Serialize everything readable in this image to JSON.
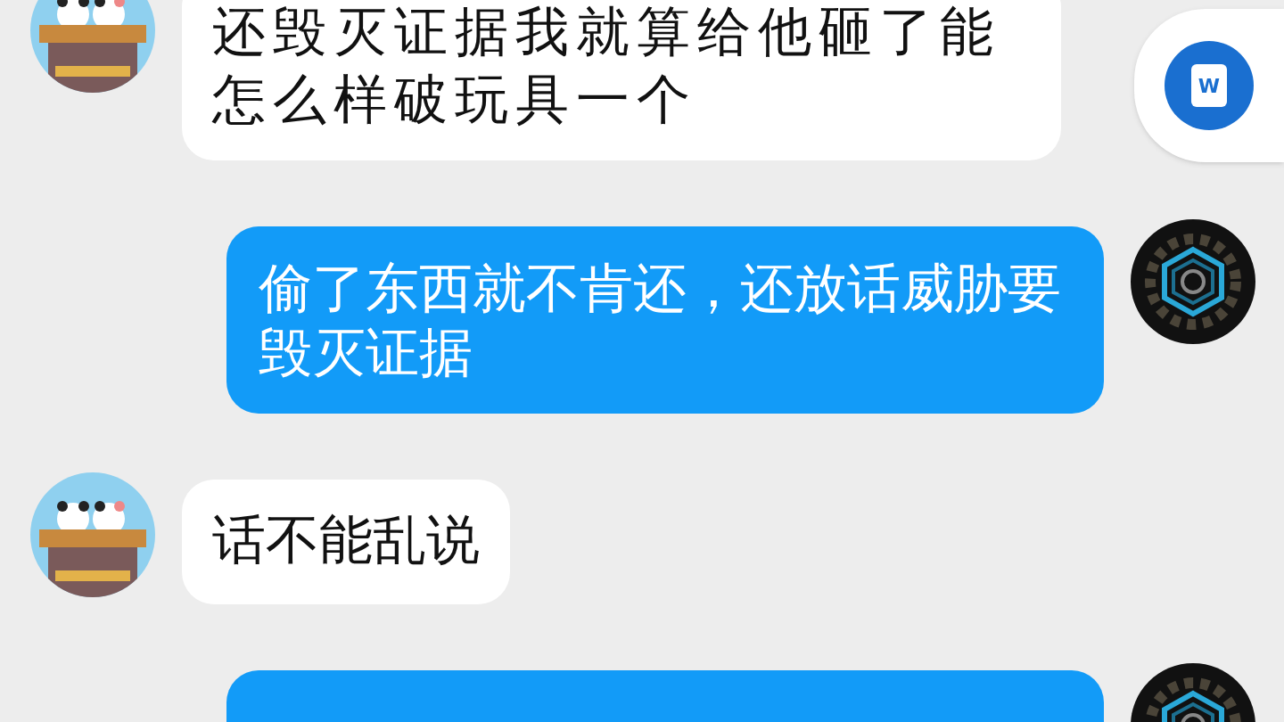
{
  "messages": [
    {
      "kind": "incoming",
      "text": "还毁灭证据我就算给他砸了能怎么样破玩具一个"
    },
    {
      "kind": "outgoing",
      "text": "偷了东西就不肯还，还放话威胁要毁灭证据"
    },
    {
      "kind": "incoming",
      "text": "话不能乱说"
    },
    {
      "kind": "outgoing"
    }
  ],
  "floating_app": {
    "label": "W"
  }
}
